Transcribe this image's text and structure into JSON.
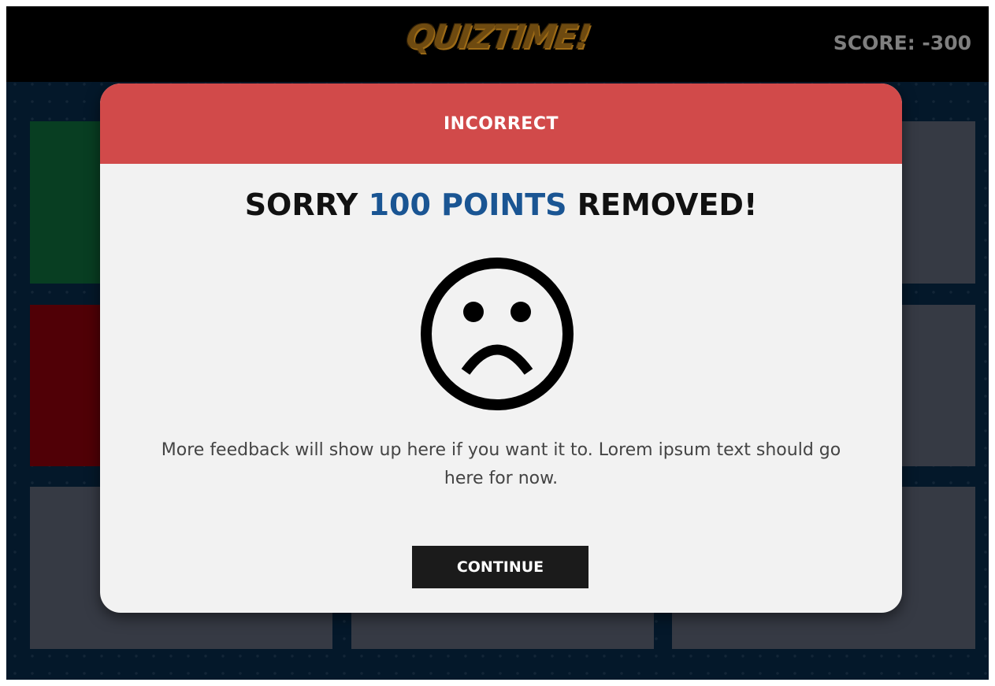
{
  "header": {
    "logo_text": "QUIZTIME!",
    "score_label": "SCORE: -300"
  },
  "colors": {
    "header_bg": "#000000",
    "board_bg": "#04182a",
    "tile_default": "#363a44",
    "tile_correct": "#083e22",
    "tile_incorrect": "#500006",
    "modal_header_bg": "#d14a4a",
    "modal_body_bg": "#f2f2f2",
    "accent_blue": "#1a5593",
    "button_bg": "#1b1b1b",
    "score_text": "#7f7f7f"
  },
  "board": {
    "tiles": [
      {
        "status": "correct"
      },
      {
        "status": "default"
      },
      {
        "status": "default"
      },
      {
        "status": "incorrect"
      },
      {
        "status": "default"
      },
      {
        "status": "default"
      },
      {
        "status": "default"
      },
      {
        "status": "default"
      },
      {
        "status": "default"
      }
    ]
  },
  "modal": {
    "header_title": "INCORRECT",
    "headline_prefix": "SORRY ",
    "headline_accent": "100 POINTS",
    "headline_suffix": " REMOVED!",
    "icon": "sad-face-icon",
    "feedback_text": "More feedback will show up here if you want it to. Lorem ipsum text should go here for now.",
    "continue_label": "CONTINUE"
  }
}
